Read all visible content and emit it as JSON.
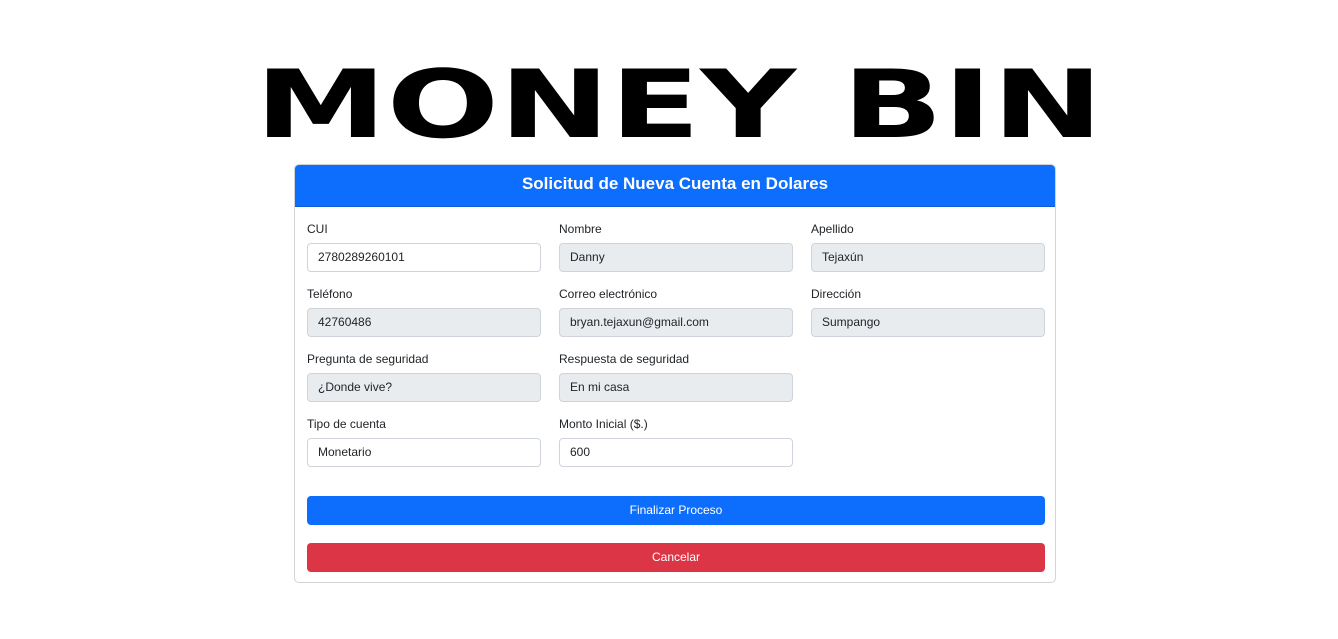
{
  "logo": {
    "text": "MONEY BIN"
  },
  "card": {
    "title": "Solicitud de Nueva Cuenta en Dolares"
  },
  "form": {
    "cui": {
      "label": "CUI",
      "value": "2780289260101"
    },
    "nombre": {
      "label": "Nombre",
      "value": "Danny"
    },
    "apellido": {
      "label": "Apellido",
      "value": "Tejaxún"
    },
    "telefono": {
      "label": "Teléfono",
      "value": "42760486"
    },
    "correo": {
      "label": "Correo electrónico",
      "value": "bryan.tejaxun@gmail.com"
    },
    "direccion": {
      "label": "Dirección",
      "value": "Sumpango"
    },
    "pregunta": {
      "label": "Pregunta de seguridad",
      "value": "¿Donde vive?"
    },
    "respuesta": {
      "label": "Respuesta de seguridad",
      "value": "En mi casa"
    },
    "tipo_cuenta": {
      "label": "Tipo de cuenta",
      "value": "Monetario"
    },
    "monto": {
      "label": "Monto Inicial ($.)",
      "value": "600"
    }
  },
  "buttons": {
    "finalizar": "Finalizar Proceso",
    "cancelar": "Cancelar"
  },
  "colors": {
    "primary": "#0d6efd",
    "danger": "#dc3545",
    "readonly_bg": "#e9ecef"
  }
}
